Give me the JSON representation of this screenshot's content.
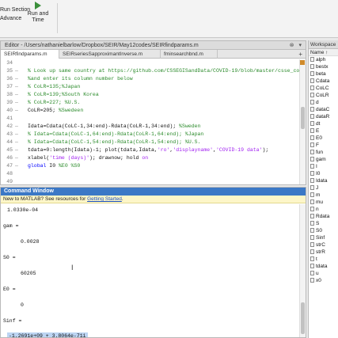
{
  "toolstrip": {
    "run_section": "Run Section",
    "advance": "Advance",
    "run_and_time": [
      "Run and",
      "Time"
    ]
  },
  "editor": {
    "title": "Editor - /Users/nathanielbarlow/Dropbox/SEIR/May12codes/SEIRfindparams.m",
    "tabs": [
      "SEIRfindparams.m",
      "SEIRseriesSapproximantInverse.m",
      "fminsearchbnd.m"
    ],
    "lines": [
      {
        "n": "34",
        "text": "",
        "type": "plain"
      },
      {
        "n": "35",
        "text": "% Look up same country at https://github.com/CSSEGISandData/COVID-19/blob/master/csse_cov",
        "type": "comment"
      },
      {
        "n": "36",
        "text": "%and enter its column number below",
        "type": "comment"
      },
      {
        "n": "37",
        "text": "% CoLR=135;%Japan",
        "type": "comment"
      },
      {
        "n": "38",
        "text": "% CoLR=139;%South Korea",
        "type": "comment"
      },
      {
        "n": "39",
        "text": "% CoLR=227; %U.S.",
        "type": "comment"
      },
      {
        "n": "40",
        "text": "CoLR=205; %Swedeen",
        "type": "mixed",
        "code": "CoLR=205; ",
        "tail": "%Swedeen"
      },
      {
        "n": "41",
        "text": "",
        "type": "plain"
      },
      {
        "n": "42",
        "text": "Idata=Cdata(CoLC-1,34:end)-Rdata(CoLR-1,34:end); %Sweden",
        "type": "mixed",
        "code": "Idata=Cdata(CoLC-1,34:end)-Rdata(CoLR-1,34:end); ",
        "tail": "%Sweden"
      },
      {
        "n": "43",
        "text": "% Idata=Cdata(CoLC-1,64:end)-Rdata(CoLR-1,64:end); %Japan",
        "type": "comment"
      },
      {
        "n": "44",
        "text": "% Idata=Cdata(CoLC-1,54:end)-Rdata(CoLR-1,54:end); %U.S.",
        "type": "comment"
      },
      {
        "n": "45",
        "text": "tdata=0:length(Idata)-1; plot(tdata,Idata,'ro','displayname','COVID-19 data');",
        "type": "plot"
      },
      {
        "n": "46",
        "text": "xlabel('time (days)'); drawnow; hold on",
        "type": "xlabel"
      },
      {
        "n": "47",
        "text": "global I0 %E0 %S0",
        "type": "global"
      },
      {
        "n": "48",
        "text": "",
        "type": "plain"
      },
      {
        "n": "49",
        "text": "",
        "type": "plain"
      },
      {
        "n": "50",
        "text": "I0=Idata(1);",
        "type": "plain"
      },
      {
        "n": "51",
        "text": "",
        "type": "plain"
      },
      {
        "n": "52",
        "text": "fun = @(x)SEIRfitNumerical(x,tdata,Idata);",
        "type": "plain"
      }
    ]
  },
  "command_window": {
    "title": "Command Window",
    "banner_prefix": "New to MATLAB? See resources for ",
    "banner_link": "Getting Started",
    "banner_suffix": ".",
    "lines": [
      {
        "text": "1.0330e-04",
        "kind": "val"
      },
      {
        "text": "gam =",
        "kind": "name"
      },
      {
        "text": "0.0028",
        "kind": "val"
      },
      {
        "text": "S0 =",
        "kind": "name"
      },
      {
        "text": "60205",
        "kind": "val"
      },
      {
        "text": "E0 =",
        "kind": "name"
      },
      {
        "text": "0",
        "kind": "val"
      },
      {
        "text": "Sinf =",
        "kind": "name"
      },
      {
        "text": "-1.2691e+09 + 3.8064e-71i",
        "kind": "selected"
      }
    ]
  },
  "workspace": {
    "title": "Workspace",
    "header": "Name ↑",
    "items": [
      "alph",
      "bestx",
      "beta",
      "Cdata",
      "CoLC",
      "CoLR",
      "d",
      "dataC",
      "dataR",
      "dt",
      "E",
      "E0",
      "F",
      "fun",
      "gam",
      "I",
      "I0",
      "Idata",
      "J",
      "m",
      "mu",
      "n",
      "Rdata",
      "S",
      "S0",
      "Sinf",
      "strC",
      "strR",
      "t",
      "tdata",
      "u",
      "x0"
    ]
  }
}
